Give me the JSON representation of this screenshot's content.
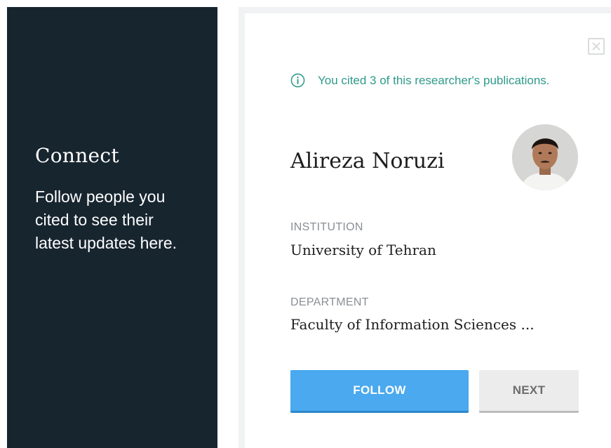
{
  "left_panel": {
    "title": "Connect",
    "description": "Follow people you cited to see their latest updates here."
  },
  "card": {
    "close_icon": "close-icon",
    "citation_notice": "You cited 3 of this researcher's publications.",
    "researcher": {
      "name": "Alireza Noruzi",
      "institution_label": "INSTITUTION",
      "institution": "University of Tehran",
      "department_label": "DEPARTMENT",
      "department": "Faculty of Information Sciences ..."
    },
    "buttons": {
      "follow": "FOLLOW",
      "next": "NEXT"
    }
  },
  "colors": {
    "panel_bg": "#17252f",
    "accent_teal": "#2f9a8a",
    "follow_blue": "#4aa9ef"
  }
}
